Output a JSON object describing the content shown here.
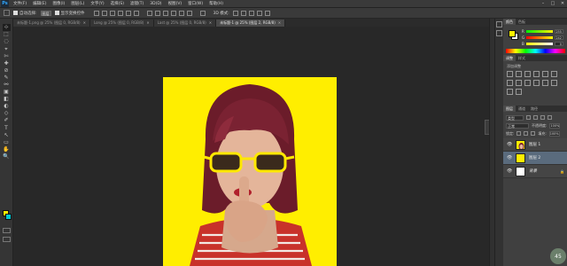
{
  "menubar": {
    "logo": "Ps",
    "items": [
      "文件(F)",
      "编辑(E)",
      "图像(I)",
      "图层(L)",
      "文字(Y)",
      "选择(S)",
      "滤镜(T)",
      "3D(D)",
      "视图(V)",
      "窗口(W)",
      "帮助(H)"
    ],
    "window_controls": [
      "–",
      "□",
      "✕"
    ]
  },
  "options_bar": {
    "auto_select_label": "自动选择:",
    "auto_select_value": "图层",
    "show_transform_label": "显示变换控件"
  },
  "doc_tabs": [
    {
      "label": "未标题-1.png @ 25% (图层 0, RGB/8)",
      "active": false
    },
    {
      "label": "Long @ 25% (图层 0, RGB/8)",
      "active": false
    },
    {
      "label": "Last @ 25% (图层 0, RGB/8)",
      "active": false
    },
    {
      "label": "未标题-1 @ 25% (图层 2, RGB/8)",
      "active": true
    }
  ],
  "tools": [
    "⊹",
    "⬚",
    "◌",
    "⌖",
    "✄",
    "✚",
    "⊘",
    "✎",
    "⚯",
    "▣",
    "◧",
    "◐",
    "◇",
    "✐",
    "T",
    "↖",
    "▭",
    "✋",
    "🔍"
  ],
  "colors": {
    "foreground": "#fff200",
    "background": "#00c8d2",
    "canvas_bg": "#ffee00"
  },
  "panels": {
    "top_tabs": [
      "颜色",
      "色板"
    ],
    "color": {
      "sliders": [
        {
          "label": "R",
          "value": "255"
        },
        {
          "label": "G",
          "value": "242"
        },
        {
          "label": "B",
          "value": "0"
        }
      ]
    },
    "adj_tabs": [
      "调整",
      "样式"
    ],
    "adj_title": "添加调整",
    "layers_tabs": [
      "图层",
      "通道",
      "路径"
    ],
    "layers": {
      "kind_label": "类型",
      "blend_mode": "正常",
      "opacity_label": "不透明度:",
      "opacity_value": "100%",
      "lock_label": "锁定:",
      "fill_label": "填充:",
      "fill_value": "100%",
      "items": [
        {
          "name": "图层 1",
          "selected": false,
          "thumb": "photo"
        },
        {
          "name": "图层 2",
          "selected": true,
          "thumb": "yellow"
        },
        {
          "name": "背景",
          "selected": false,
          "thumb": "white"
        }
      ]
    }
  },
  "speed_badge": "45"
}
